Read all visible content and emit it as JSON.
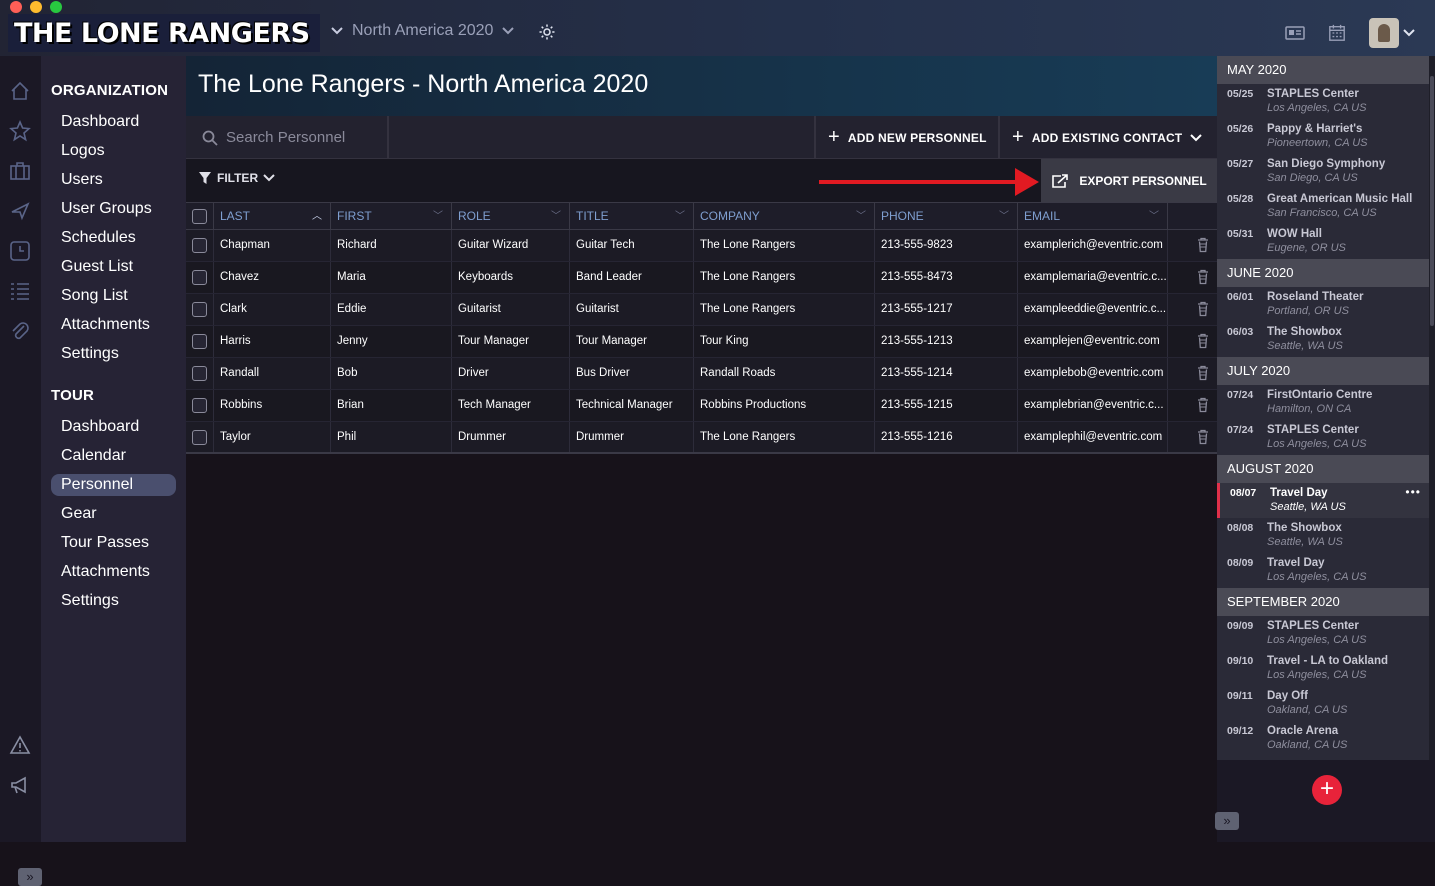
{
  "app": {
    "logo_text": "THE LONE RANGERS",
    "tour_selector": "North America 2020",
    "colors": {
      "accent_red": "#e21a22",
      "header_blue": "#7f9fd0",
      "fab_red": "#e8233a",
      "active_nav": "#4a4f6e"
    }
  },
  "rail_icons": [
    "home-icon",
    "star-icon",
    "briefcase-icon",
    "plane-icon",
    "clock-icon",
    "list-icon",
    "paperclip-icon",
    "warning-icon",
    "megaphone-icon"
  ],
  "nav": {
    "org_heading": "ORGANIZATION",
    "org_items": [
      "Dashboard",
      "Logos",
      "Users",
      "User Groups",
      "Schedules",
      "Guest List",
      "Song List",
      "Attachments",
      "Settings"
    ],
    "tour_heading": "TOUR",
    "tour_items": [
      "Dashboard",
      "Calendar",
      "Personnel",
      "Gear",
      "Tour Passes",
      "Attachments",
      "Settings"
    ],
    "active_item": "Personnel"
  },
  "page": {
    "title": "The Lone Rangers - North America 2020"
  },
  "toolbar": {
    "search_placeholder": "Search Personnel",
    "add_new": "ADD NEW PERSONNEL",
    "add_existing": "ADD EXISTING CONTACT",
    "filter": "FILTER",
    "export": "EXPORT PERSONNEL"
  },
  "table": {
    "columns": [
      "LAST",
      "FIRST",
      "ROLE",
      "TITLE",
      "COMPANY",
      "PHONE",
      "EMAIL"
    ],
    "sorted_column": "LAST",
    "rows": [
      {
        "last": "Chapman",
        "first": "Richard",
        "role": "Guitar Wizard",
        "title": "Guitar Tech",
        "company": "The Lone Rangers",
        "phone": "213-555-9823",
        "email": "examplerich@eventric.com"
      },
      {
        "last": "Chavez",
        "first": "Maria",
        "role": "Keyboards",
        "title": "Band Leader",
        "company": "The Lone Rangers",
        "phone": "213-555-8473",
        "email": "examplemaria@eventric.c..."
      },
      {
        "last": "Clark",
        "first": "Eddie",
        "role": "Guitarist",
        "title": "Guitarist",
        "company": "The Lone Rangers",
        "phone": "213-555-1217",
        "email": "exampleeddie@eventric.c..."
      },
      {
        "last": "Harris",
        "first": "Jenny",
        "role": "Tour Manager",
        "title": "Tour Manager",
        "company": "Tour King",
        "phone": "213-555-1213",
        "email": "examplejen@eventric.com"
      },
      {
        "last": "Randall",
        "first": "Bob",
        "role": "Driver",
        "title": "Bus Driver",
        "company": "Randall Roads",
        "phone": "213-555-1214",
        "email": "examplebob@eventric.com"
      },
      {
        "last": "Robbins",
        "first": "Brian",
        "role": "Tech Manager",
        "title": "Technical Manager",
        "company": "Robbins Productions",
        "phone": "213-555-1215",
        "email": "examplebrian@eventric.c..."
      },
      {
        "last": "Taylor",
        "first": "Phil",
        "role": "Drummer",
        "title": "Drummer",
        "company": "The Lone Rangers",
        "phone": "213-555-1216",
        "email": "examplephil@eventric.com"
      }
    ]
  },
  "schedule": [
    {
      "month": "MAY 2020",
      "events": [
        {
          "date": "05/25",
          "venue": "STAPLES Center",
          "loc": "Los Angeles, CA US"
        },
        {
          "date": "05/26",
          "venue": "Pappy & Harriet's",
          "loc": "Pioneertown, CA US"
        },
        {
          "date": "05/27",
          "venue": "San Diego Symphony",
          "loc": "San Diego, CA US"
        },
        {
          "date": "05/28",
          "venue": "Great American Music Hall",
          "loc": "San Francisco, CA US"
        },
        {
          "date": "05/31",
          "venue": "WOW Hall",
          "loc": "Eugene, OR US"
        }
      ]
    },
    {
      "month": "JUNE 2020",
      "events": [
        {
          "date": "06/01",
          "venue": "Roseland Theater",
          "loc": "Portland, OR US"
        },
        {
          "date": "06/03",
          "venue": "The Showbox",
          "loc": "Seattle, WA US"
        }
      ]
    },
    {
      "month": "JULY 2020",
      "events": [
        {
          "date": "07/24",
          "venue": "FirstOntario Centre",
          "loc": "Hamilton, ON CA"
        },
        {
          "date": "07/24",
          "venue": "STAPLES Center",
          "loc": "Los Angeles, CA US"
        }
      ]
    },
    {
      "month": "AUGUST 2020",
      "events": [
        {
          "date": "08/07",
          "venue": "Travel Day",
          "loc": "Seattle, WA US",
          "selected": true
        },
        {
          "date": "08/08",
          "venue": "The Showbox",
          "loc": "Seattle, WA US"
        },
        {
          "date": "08/09",
          "venue": "Travel Day",
          "loc": "Los Angeles, CA US"
        }
      ]
    },
    {
      "month": "SEPTEMBER 2020",
      "events": [
        {
          "date": "09/09",
          "venue": "STAPLES Center",
          "loc": "Los Angeles, CA US"
        },
        {
          "date": "09/10",
          "venue": "Travel - LA to Oakland",
          "loc": "Los Angeles, CA US"
        },
        {
          "date": "09/11",
          "venue": "Day Off",
          "loc": "Oakland, CA US"
        },
        {
          "date": "09/12",
          "venue": "Oracle Arena",
          "loc": "Oakland, CA US"
        }
      ]
    }
  ]
}
